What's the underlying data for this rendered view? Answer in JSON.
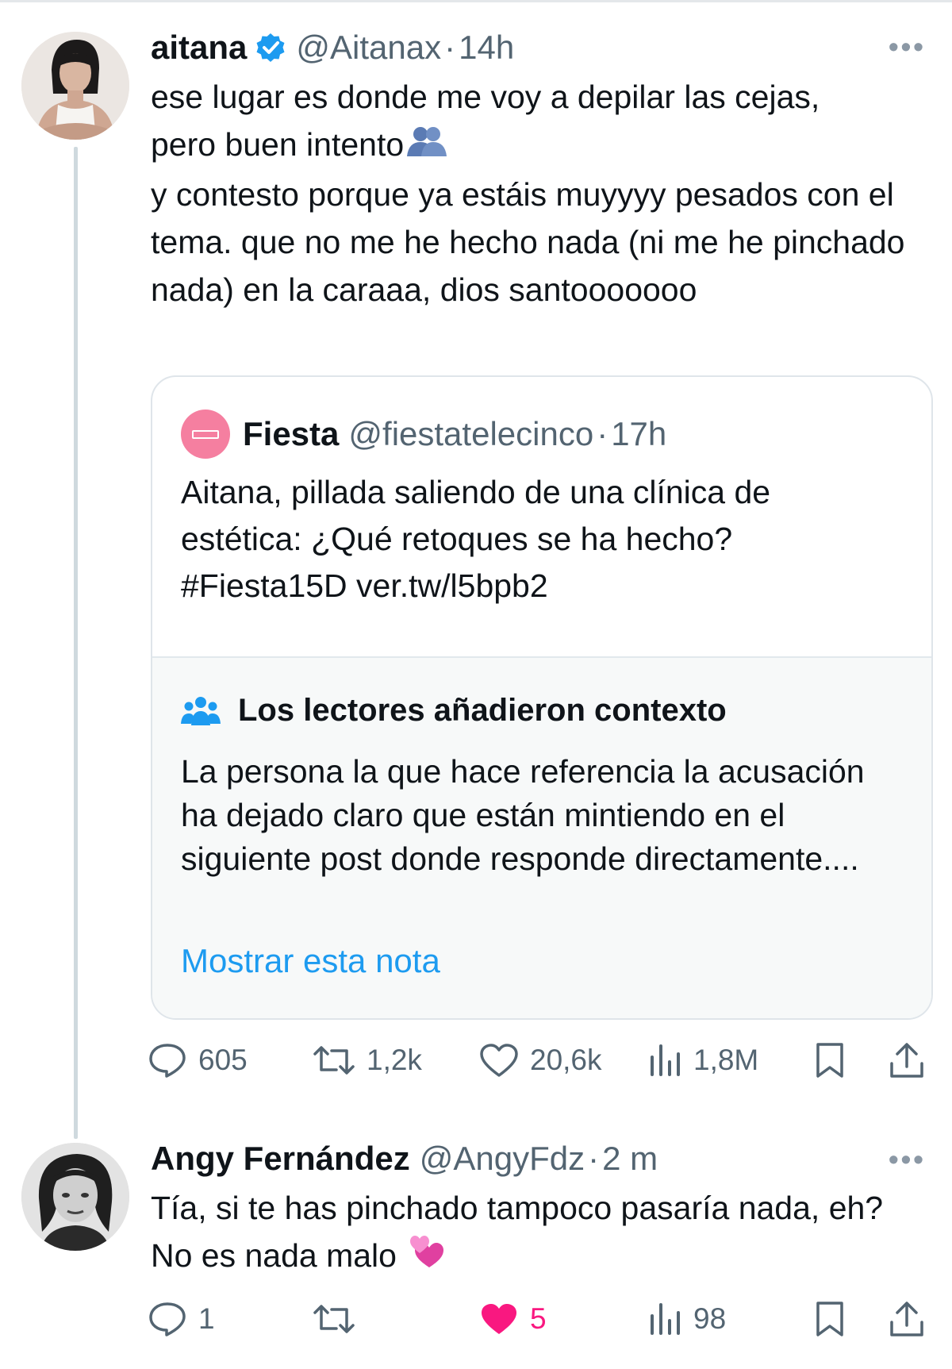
{
  "tweet": {
    "author_name": "aitana",
    "handle": "@Aitanax",
    "separator": "·",
    "time": "14h",
    "text_line1": "ese lugar es donde me voy a depilar las cejas,",
    "text_line2": "pero buen intento",
    "text_line3": "y contesto porque ya estáis muyyyy pesados con el tema. que no me he hecho nada (ni me he pinchado nada) en la caraaa, dios santooooooo",
    "emoji": "hugging-people-emoji",
    "quote": {
      "author_name": "Fiesta",
      "handle": "@fiestatelecinco",
      "separator": "·",
      "time": "17h",
      "text": "Aitana, pillada saliendo de una clínica de estética: ¿Qué retoques se ha hecho? #Fiesta15D ver.tw/l5bpb2",
      "avatar_color": "#f57fa0"
    },
    "community_note": {
      "title": "Los lectores añadieron contexto",
      "text": "La persona la que hace referencia la acusación ha dejado claro que están mintiendo en el siguiente post donde responde directamente....",
      "link": "Mostrar esta nota"
    },
    "actions": {
      "replies": "605",
      "reposts": "1,2k",
      "likes": "20,6k",
      "views": "1,8M"
    }
  },
  "reply": {
    "author_name": "Angy Fernández",
    "handle": "@AngyFdz",
    "separator": "·",
    "time": "2 m",
    "text": "Tía, si te has pinchado tampoco pasaría nada, eh? No es nada malo",
    "emoji": "two-hearts-emoji",
    "actions": {
      "replies": "1",
      "reposts": "",
      "likes": "5",
      "views": "98"
    }
  },
  "colors": {
    "accent": "#1d9bf0",
    "secondary_text": "#536471",
    "like_active": "#f91880",
    "thread_line": "#cfd9de"
  }
}
